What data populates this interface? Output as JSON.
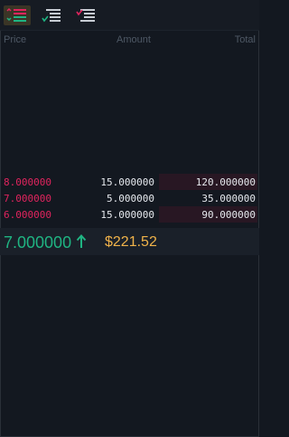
{
  "header": {
    "price": "Price",
    "amount": "Amount",
    "total": "Total"
  },
  "asks": [
    {
      "price": "8.000000",
      "amount": "15.000000",
      "total": "120.000000",
      "depth_pct": 38
    },
    {
      "price": "7.000000",
      "amount": "5.000000",
      "total": "35.000000",
      "depth_pct": 38
    },
    {
      "price": "6.000000",
      "amount": "15.000000",
      "total": "90.000000",
      "depth_pct": 38
    }
  ],
  "last_trade": {
    "price": "7.000000",
    "usd": "$221.52"
  },
  "colors": {
    "sell": "#e0245e",
    "buy": "#1fb482",
    "usd": "#f0b34a"
  }
}
